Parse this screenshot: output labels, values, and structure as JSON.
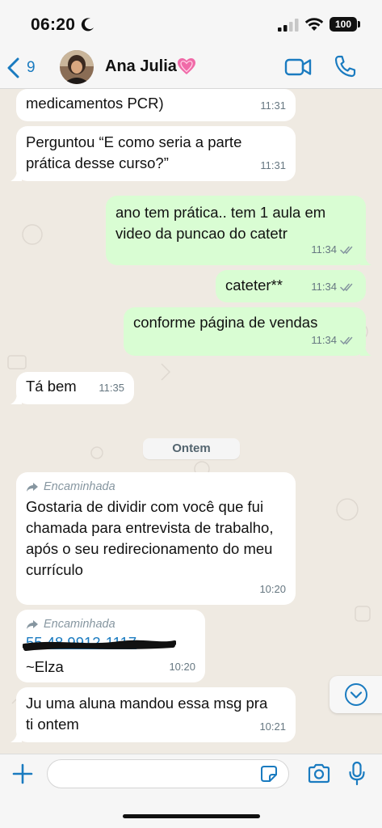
{
  "status_bar": {
    "time": "06:20",
    "battery": "100"
  },
  "header": {
    "back_count": "9",
    "contact_name": "Ana Julia"
  },
  "messages": [
    {
      "direction": "in",
      "text": "medicamentos PCR)",
      "time": "11:31"
    },
    {
      "direction": "in",
      "text": "Perguntou “E como seria a parte prática desse curso?”",
      "time": "11:31"
    },
    {
      "direction": "out",
      "text": "ano tem prática.. tem 1 aula em video da puncao do catetr",
      "time": "11:34"
    },
    {
      "direction": "out",
      "text": "cateter**",
      "time": "11:34"
    },
    {
      "direction": "out",
      "text": "conforme página de vendas",
      "time": "11:34"
    },
    {
      "direction": "in",
      "text": "Tá bem",
      "time": "11:35"
    },
    {
      "direction": "in",
      "forwarded": "Encaminhada",
      "text": "Gostaria de dividir com você que fui chamada para entrevista de trabalho, após o seu redirecionamento do meu currículo",
      "time": "10:20"
    },
    {
      "direction": "in",
      "forwarded": "Encaminhada",
      "link": "55 48 9912-1117",
      "text": "~Elza",
      "time": "10:20"
    },
    {
      "direction": "in",
      "text": "Ju uma aluna mandou essa msg pra ti ontem",
      "time": "10:21"
    }
  ],
  "date_divider": "Ontem",
  "composer": {
    "value": "",
    "placeholder": ""
  },
  "colors": {
    "incoming": "#ffffff",
    "outgoing": "#d9fdd3",
    "accent": "#1a7bc0",
    "background": "#efeae2"
  },
  "icons": [
    "moon-icon",
    "signal-icon",
    "wifi-icon",
    "battery-icon",
    "chevron-left-icon",
    "heart-icon",
    "video-call-icon",
    "phone-icon",
    "double-check-icon",
    "forward-arrow-icon",
    "chevron-down-circle-icon",
    "plus-icon",
    "sticker-icon",
    "camera-icon",
    "microphone-icon"
  ]
}
